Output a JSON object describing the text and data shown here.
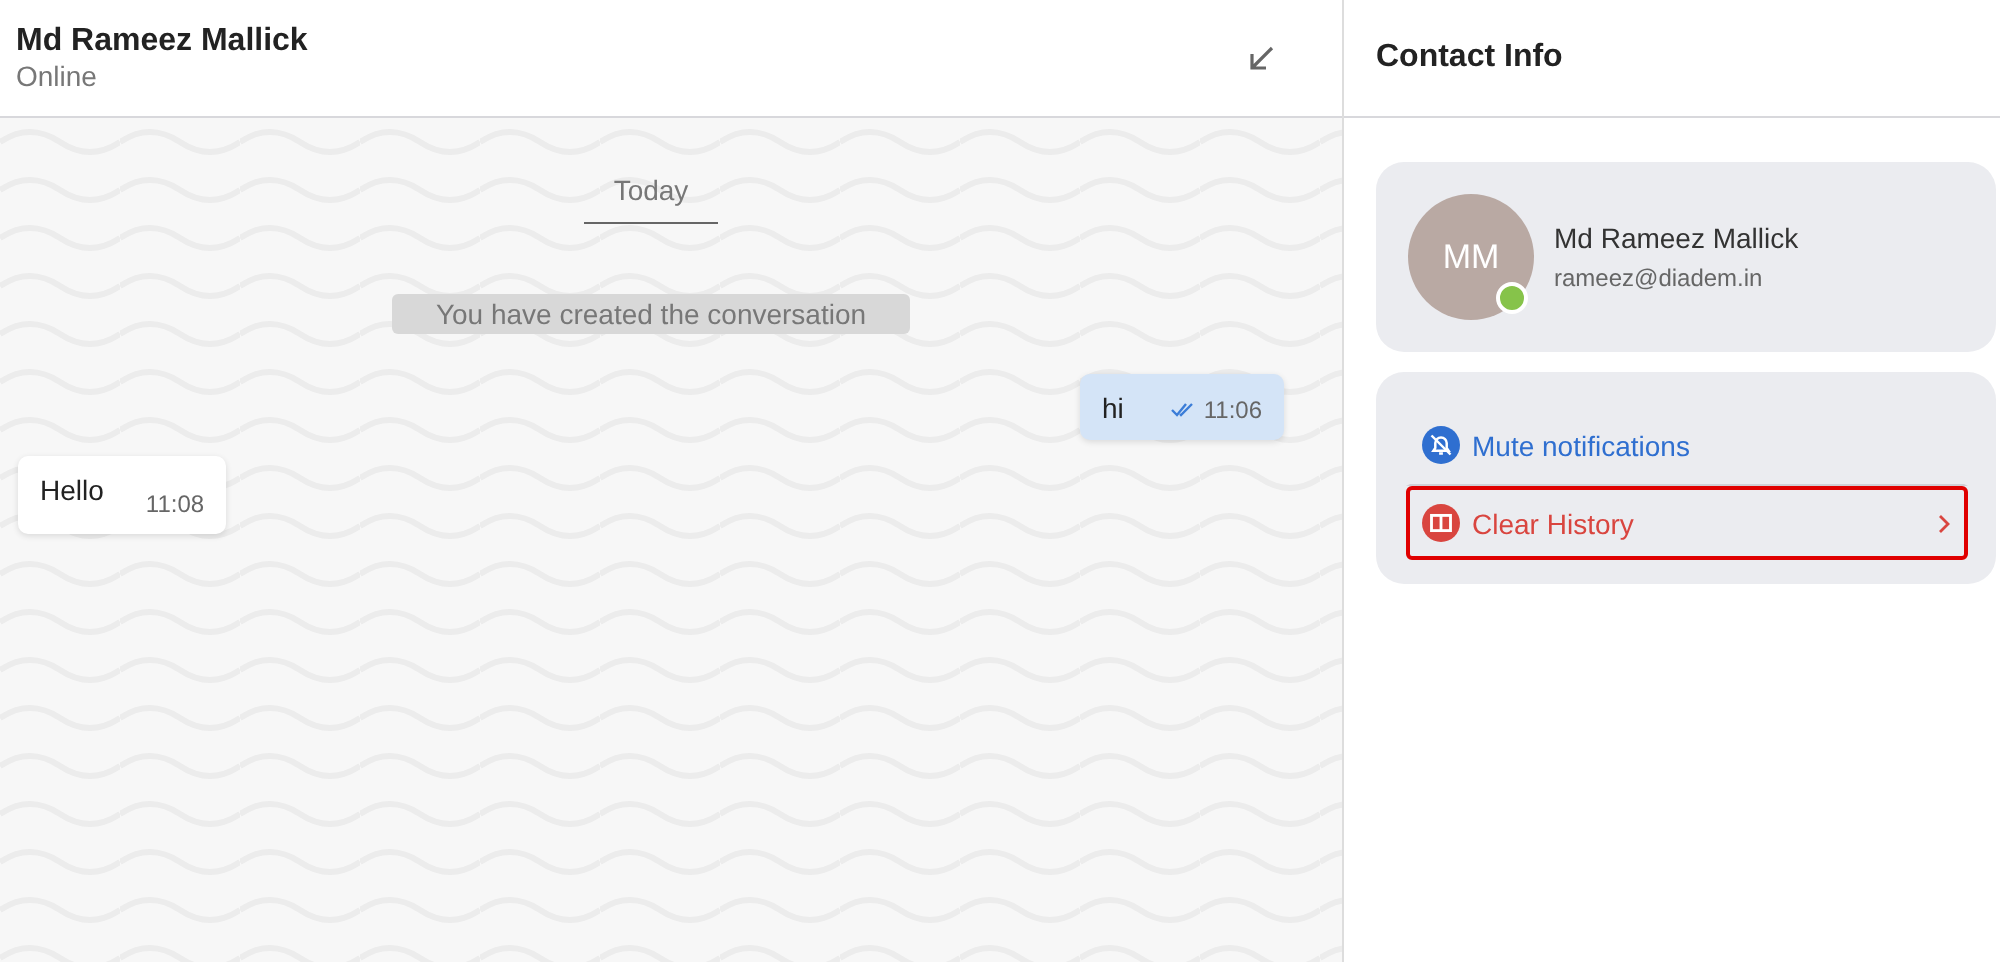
{
  "chat": {
    "header": {
      "name": "Md Rameez Mallick",
      "status": "Online"
    },
    "messages": [
      {
        "kind": "date",
        "text": "Today"
      },
      {
        "kind": "system",
        "text": "You have created the conversation"
      },
      {
        "kind": "outgoing",
        "text": "hi",
        "time": "11:06",
        "read": true
      },
      {
        "kind": "incoming",
        "text": "Hello",
        "time": "11:08"
      }
    ]
  },
  "contact_info": {
    "title": "Contact Info",
    "initials": "MM",
    "online": true,
    "name": "Md Rameez Mallick",
    "email": "rameez@diadem.in",
    "actions": [
      {
        "kind": "mute",
        "label": "Mute notifications",
        "chevron": false,
        "highlighted": false
      },
      {
        "kind": "clear",
        "label": "Clear History",
        "chevron": true,
        "highlighted": true
      }
    ]
  }
}
